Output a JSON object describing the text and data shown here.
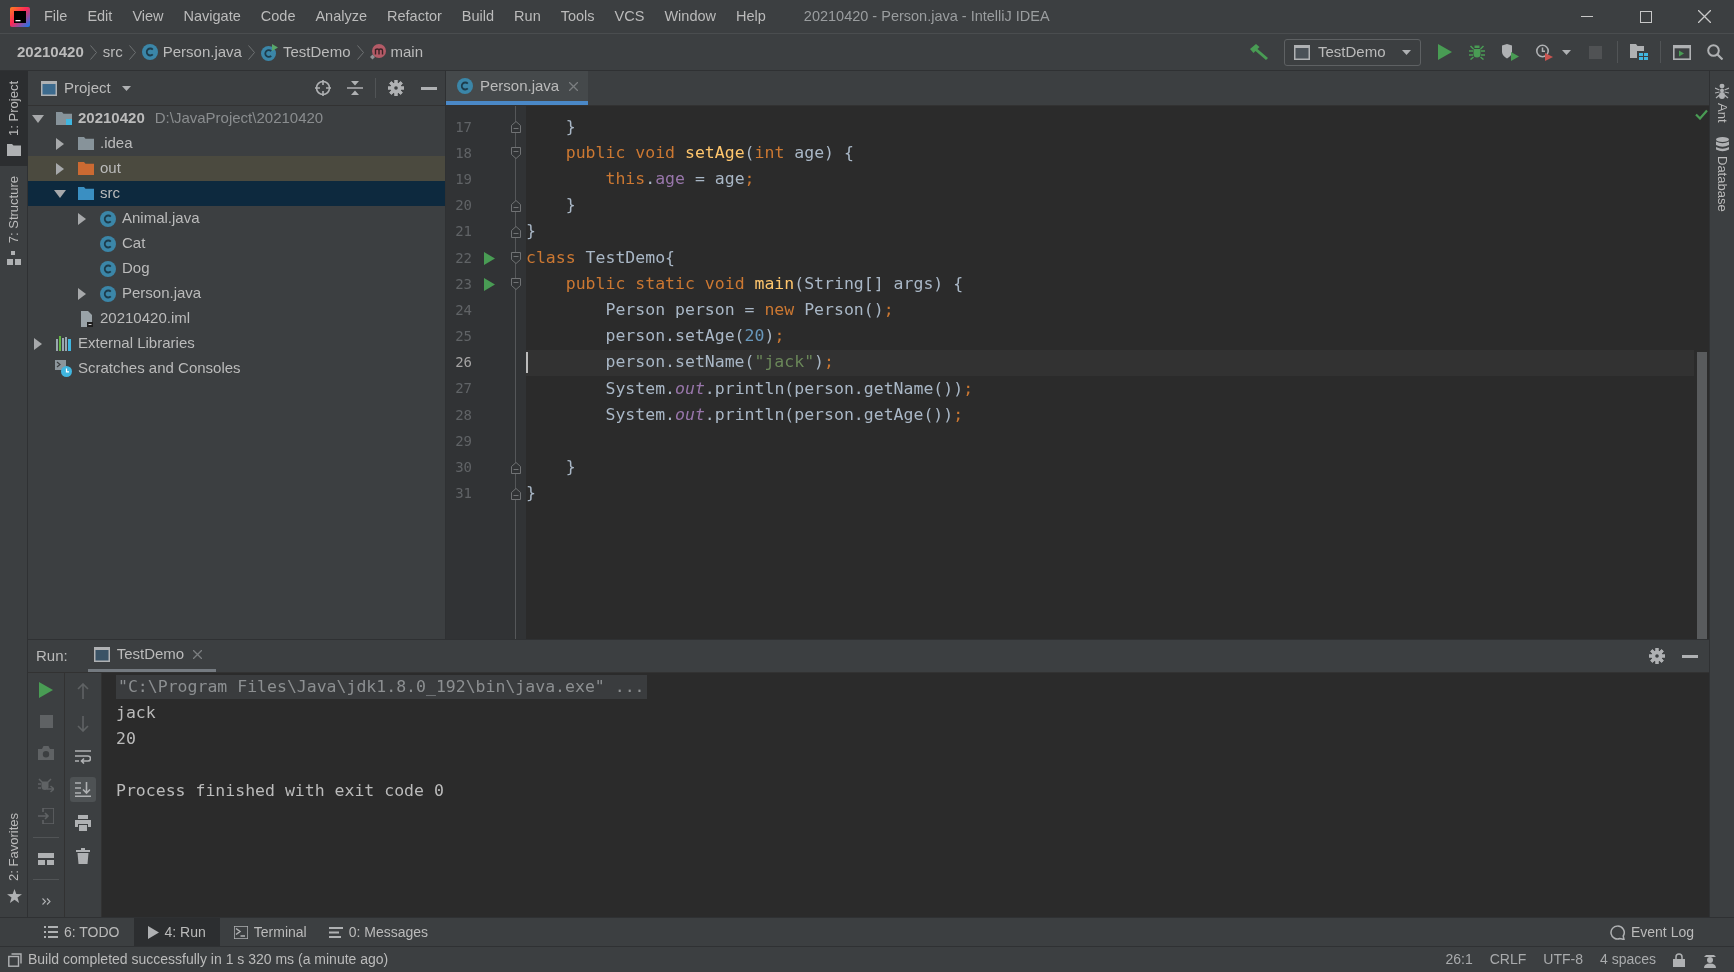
{
  "window": {
    "title": "20210420 - Person.java - IntelliJ IDEA"
  },
  "menu": [
    "File",
    "Edit",
    "View",
    "Navigate",
    "Code",
    "Analyze",
    "Refactor",
    "Build",
    "Run",
    "Tools",
    "VCS",
    "Window",
    "Help"
  ],
  "breadcrumbs": [
    {
      "label": "20210420",
      "kind": "project"
    },
    {
      "label": "src",
      "kind": "folder"
    },
    {
      "label": "Person.java",
      "kind": "class"
    },
    {
      "label": "TestDemo",
      "kind": "runnable-class"
    },
    {
      "label": "main",
      "kind": "method"
    }
  ],
  "toolbar": {
    "run_config": "TestDemo",
    "actions": [
      {
        "kind": "run",
        "disabled": false
      },
      {
        "kind": "debug",
        "disabled": false
      },
      {
        "kind": "coverage",
        "disabled": false
      },
      {
        "kind": "profile",
        "disabled": false
      },
      {
        "kind": "stop",
        "disabled": true
      }
    ]
  },
  "left_strip": {
    "top": [
      {
        "label": "1: Project",
        "kind": "project",
        "selected": true
      },
      {
        "label": "7: Structure",
        "kind": "structure",
        "selected": false
      }
    ],
    "bottom": [
      {
        "label": "2: Favorites",
        "kind": "favorites",
        "selected": false
      }
    ]
  },
  "right_strip": [
    {
      "label": "Ant",
      "kind": "ant"
    },
    {
      "label": "Database",
      "kind": "database"
    }
  ],
  "project_panel": {
    "title": "Project",
    "tree": [
      {
        "label": "20210420",
        "detail": "D:\\JavaProject\\20210420",
        "kind": "module",
        "expanded": true,
        "selected": false,
        "children": [
          {
            "label": ".idea",
            "kind": "folder",
            "expanded": false,
            "selected": false
          },
          {
            "label": "out",
            "kind": "excluded-folder",
            "expanded": false,
            "selected": false
          },
          {
            "label": "src",
            "kind": "source-folder",
            "expanded": true,
            "selected": true,
            "children": [
              {
                "label": "Animal.java",
                "kind": "class",
                "expanded": false,
                "selected": false
              },
              {
                "label": "Cat",
                "kind": "class",
                "selected": false
              },
              {
                "label": "Dog",
                "kind": "class",
                "selected": false
              },
              {
                "label": "Person.java",
                "kind": "class",
                "expanded": false,
                "selected": false
              }
            ]
          },
          {
            "label": "20210420.iml",
            "kind": "module-file",
            "selected": false
          }
        ]
      },
      {
        "label": "External Libraries",
        "kind": "libraries",
        "expanded": false,
        "selected": false
      },
      {
        "label": "Scratches and Consoles",
        "kind": "scratches",
        "selected": false
      }
    ]
  },
  "editor": {
    "tabs": [
      {
        "label": "Person.java",
        "selected": true
      }
    ],
    "lines": [
      {
        "number": "17",
        "current": false,
        "run": false,
        "fold_start": false,
        "fold_end": true,
        "tokens": [
          {
            "text": "    }",
            "kind": "plain"
          }
        ]
      },
      {
        "number": "18",
        "current": false,
        "run": false,
        "fold_start": true,
        "fold_end": false,
        "tokens": [
          {
            "text": "    public void ",
            "kind": "keyword"
          },
          {
            "text": "setAge",
            "kind": "method"
          },
          {
            "text": "(",
            "kind": "plain"
          },
          {
            "text": "int ",
            "kind": "keyword"
          },
          {
            "text": "age) {",
            "kind": "plain"
          }
        ]
      },
      {
        "number": "19",
        "current": false,
        "run": false,
        "fold_start": false,
        "fold_end": false,
        "tokens": [
          {
            "text": "        this",
            "kind": "keyword"
          },
          {
            "text": ".",
            "kind": "plain"
          },
          {
            "text": "age",
            "kind": "field"
          },
          {
            "text": " = age",
            "kind": "plain"
          },
          {
            "text": ";",
            "kind": "keyword"
          }
        ]
      },
      {
        "number": "20",
        "current": false,
        "run": false,
        "fold_start": false,
        "fold_end": true,
        "tokens": [
          {
            "text": "    }",
            "kind": "plain"
          }
        ]
      },
      {
        "number": "21",
        "current": false,
        "run": false,
        "fold_start": false,
        "fold_end": true,
        "tokens": [
          {
            "text": "}",
            "kind": "plain"
          }
        ]
      },
      {
        "number": "22",
        "current": false,
        "run": true,
        "fold_start": true,
        "fold_end": false,
        "tokens": [
          {
            "text": "class ",
            "kind": "keyword"
          },
          {
            "text": "TestDemo{",
            "kind": "plain"
          }
        ]
      },
      {
        "number": "23",
        "current": false,
        "run": true,
        "fold_start": true,
        "fold_end": false,
        "tokens": [
          {
            "text": "    public static void ",
            "kind": "keyword"
          },
          {
            "text": "main",
            "kind": "method"
          },
          {
            "text": "(String[] args) {",
            "kind": "plain"
          }
        ]
      },
      {
        "number": "24",
        "current": false,
        "run": false,
        "fold_start": false,
        "fold_end": false,
        "tokens": [
          {
            "text": "        Person person = ",
            "kind": "plain"
          },
          {
            "text": "new ",
            "kind": "keyword"
          },
          {
            "text": "Person()",
            "kind": "plain"
          },
          {
            "text": ";",
            "kind": "keyword"
          }
        ]
      },
      {
        "number": "25",
        "current": false,
        "run": false,
        "fold_start": false,
        "fold_end": false,
        "tokens": [
          {
            "text": "        person.setAge(",
            "kind": "plain"
          },
          {
            "text": "20",
            "kind": "number"
          },
          {
            "text": ")",
            "kind": "plain"
          },
          {
            "text": ";",
            "kind": "keyword"
          }
        ]
      },
      {
        "number": "26",
        "current": true,
        "run": false,
        "fold_start": false,
        "fold_end": false,
        "tokens": [
          {
            "text": "        person.setName(",
            "kind": "plain"
          },
          {
            "text": "\"jack\"",
            "kind": "string"
          },
          {
            "text": ")",
            "kind": "plain"
          },
          {
            "text": ";",
            "kind": "keyword"
          }
        ]
      },
      {
        "number": "27",
        "current": false,
        "run": false,
        "fold_start": false,
        "fold_end": false,
        "tokens": [
          {
            "text": "        System.",
            "kind": "plain"
          },
          {
            "text": "out",
            "kind": "static"
          },
          {
            "text": ".println(person.getName())",
            "kind": "plain"
          },
          {
            "text": ";",
            "kind": "keyword"
          }
        ]
      },
      {
        "number": "28",
        "current": false,
        "run": false,
        "fold_start": false,
        "fold_end": false,
        "tokens": [
          {
            "text": "        System.",
            "kind": "plain"
          },
          {
            "text": "out",
            "kind": "static"
          },
          {
            "text": ".println(person.getAge())",
            "kind": "plain"
          },
          {
            "text": ";",
            "kind": "keyword"
          }
        ]
      },
      {
        "number": "29",
        "current": false,
        "run": false,
        "fold_start": false,
        "fold_end": false
      },
      {
        "number": "30",
        "current": false,
        "run": false,
        "fold_start": false,
        "fold_end": true,
        "tokens": [
          {
            "text": "    }",
            "kind": "plain"
          }
        ]
      },
      {
        "number": "31",
        "current": false,
        "run": false,
        "fold_start": false,
        "fold_end": true,
        "tokens": [
          {
            "text": "}",
            "kind": "plain"
          }
        ]
      }
    ]
  },
  "run_panel": {
    "label": "Run:",
    "tabs": [
      {
        "label": "TestDemo",
        "selected": true
      }
    ],
    "action_columns": [
      [
        {
          "kind": "rerun",
          "disabled": false,
          "on": false
        },
        {
          "kind": "stop",
          "disabled": true,
          "on": false
        },
        {
          "kind": "dump",
          "disabled": true,
          "on": false
        },
        {
          "kind": "debug",
          "disabled": true,
          "on": false
        },
        {
          "kind": "exit",
          "disabled": true,
          "on": false
        },
        {
          "kind": "layout",
          "disabled": false,
          "on": false
        },
        {
          "kind": "more",
          "disabled": false,
          "on": false
        }
      ],
      [
        {
          "kind": "up",
          "disabled": true,
          "on": false
        },
        {
          "kind": "down",
          "disabled": true,
          "on": false
        },
        {
          "kind": "wrap",
          "disabled": false,
          "on": false
        },
        {
          "kind": "scroll-end",
          "disabled": false,
          "on": true
        },
        {
          "kind": "print",
          "disabled": false,
          "on": false
        },
        {
          "kind": "clear",
          "disabled": false,
          "on": false
        }
      ]
    ],
    "console": [
      {
        "kind": "command",
        "text": "\"C:\\Program Files\\Java\\jdk1.8.0_192\\bin\\java.exe\" ..."
      },
      {
        "kind": "output",
        "text": "jack"
      },
      {
        "kind": "output",
        "text": "20"
      },
      {
        "kind": "system",
        "text": "Process finished with exit code 0"
      }
    ]
  },
  "tool_window_bar": {
    "tabs": [
      {
        "label": "6: TODO",
        "kind": "todo",
        "selected": false
      },
      {
        "label": "4: Run",
        "kind": "run",
        "selected": true
      },
      {
        "label": "Terminal",
        "kind": "terminal",
        "selected": false
      },
      {
        "label": "0: Messages",
        "kind": "messages",
        "selected": false
      }
    ],
    "event_log": "Event Log"
  },
  "status_bar": {
    "message": "Build completed successfully in 1 s 320 ms (a minute ago)",
    "items": [
      "26:1",
      "CRLF",
      "UTF-8",
      "4 spaces"
    ]
  }
}
